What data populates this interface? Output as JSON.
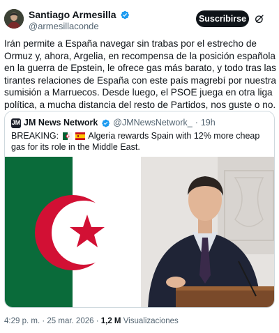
{
  "author": {
    "name": "Santiago Armesilla",
    "handle": "@armesillaconde",
    "verified": true
  },
  "actions": {
    "subscribe_label": "Suscribirse",
    "grok_icon": "grok-icon"
  },
  "tweet": {
    "text": "Irán permite a España navegar sin trabas por el estrecho de Ormuz y, ahora, Argelia, en recompensa de la posición española en la guerra de Epstein, le ofrece gas más barato, y todo tras las tirantes relaciones de España con este país magrebí por nuestra sumisión a Marruecos. Desde luego, el PSOE juega en otra liga política, a mucha distancia del resto de Partidos, nos guste o no."
  },
  "quote": {
    "name": "JM News Network",
    "handle": "@JMNewsNetwork_",
    "separator": "·",
    "time": "19h",
    "text_prefix": "BREAKING:",
    "text_body": "Algeria rewards Spain with 12% more cheap gas for its role in the Middle East.",
    "images": [
      "algeria-flag",
      "speaker-photo"
    ]
  },
  "meta": {
    "time": "4:29 p. m.",
    "date_separator": " · ",
    "date": "25 mar. 2026",
    "views_count": "1,2 M",
    "views_label": "Visualizaciones"
  },
  "colors": {
    "text": "#0f1419",
    "secondary": "#536471",
    "verified_blue": "#1d9bf0",
    "algeria_green": "#006233",
    "algeria_red": "#d21034"
  }
}
